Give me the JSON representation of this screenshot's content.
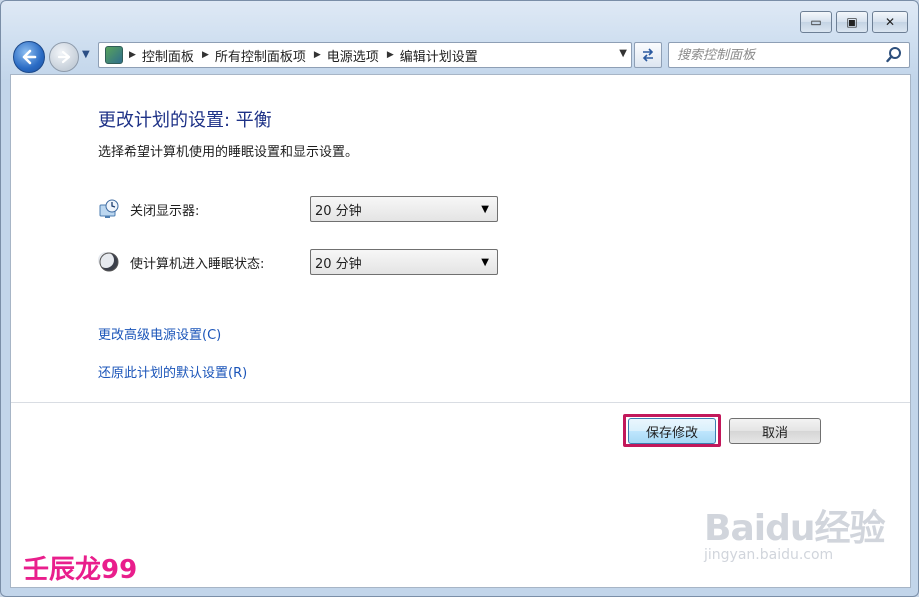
{
  "window": {
    "controls": {
      "minimize": "▭",
      "maximize": "▣",
      "close": "✕"
    }
  },
  "nav": {
    "back_icon": "arrow-left",
    "forward_icon": "arrow-right",
    "recent_icon": "chevron-down"
  },
  "address": {
    "crumbs": [
      "控制面板",
      "所有控制面板项",
      "电源选项",
      "编辑计划设置"
    ],
    "dropdown_icon": "chevron-down"
  },
  "search": {
    "placeholder": "搜索控制面板"
  },
  "main": {
    "title": "更改计划的设置: 平衡",
    "subtitle": "选择希望计算机使用的睡眠设置和显示设置。",
    "settings": [
      {
        "label": "关闭显示器:",
        "value": "20 分钟",
        "icon": "display-clock-icon"
      },
      {
        "label": "使计算机进入睡眠状态:",
        "value": "20 分钟",
        "icon": "moon-icon"
      }
    ],
    "links": {
      "advanced": "更改高级电源设置(C)",
      "restore": "还原此计划的默认设置(R)"
    },
    "buttons": {
      "save": "保存修改",
      "cancel": "取消"
    }
  },
  "watermarks": {
    "author": "壬辰龙99",
    "brand": "Baidu经验",
    "brand_url": "jingyan.baidu.com"
  },
  "colors": {
    "title": "#1e3287",
    "link": "#1b55b9",
    "highlight": "#c2185b"
  }
}
